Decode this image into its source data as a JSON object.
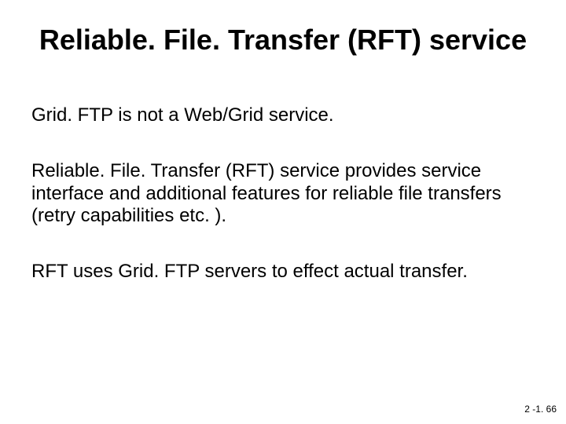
{
  "title": "Reliable. File. Transfer (RFT) service",
  "paragraphs": [
    "Grid. FTP is not a Web/Grid service.",
    "Reliable. File. Transfer (RFT) service provides service interface and additional features for reliable file transfers (retry capabilities etc. ).",
    "RFT uses Grid. FTP servers to effect  actual transfer."
  ],
  "footer": "2 -1. 66"
}
